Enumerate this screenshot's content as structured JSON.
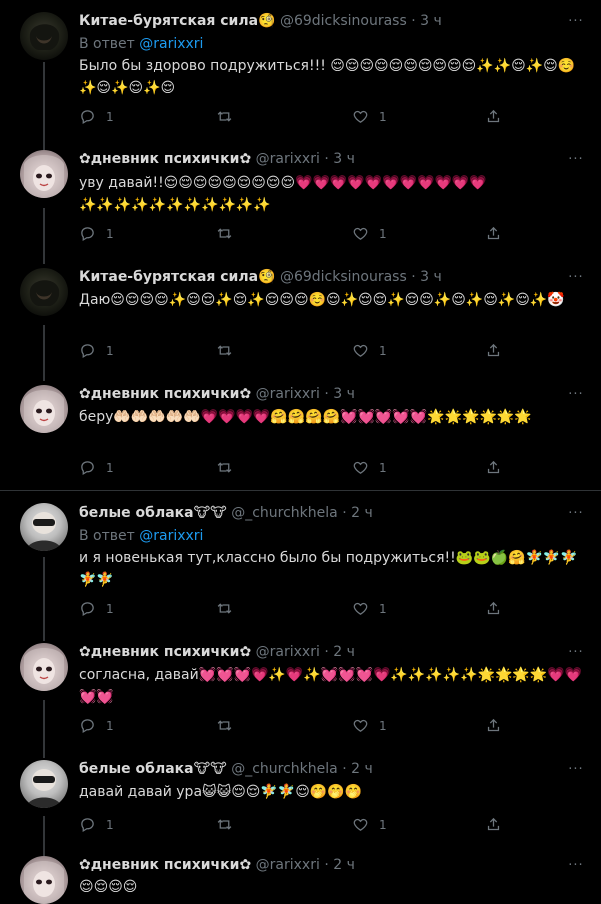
{
  "tweets": [
    {
      "name": "Китае-бурятская сила🧐",
      "handle": "@69dicksinourass",
      "dot": "·",
      "time": "3 ч",
      "reply_prefix": "В ответ ",
      "reply_to": "@rarixxri",
      "text": "Было бы здорово подружиться!!! 😌😌😌😌😌😌😌😌😌😌✨✨😌✨😌☺️✨😌✨😌✨😌",
      "replies": "1",
      "retweets": "",
      "likes": "1"
    },
    {
      "name": "✿дневник психички✿",
      "handle": "@rarixxri",
      "dot": "·",
      "time": "3 ч",
      "text": "уву давай!!😌😌😌😌😌😌😌😌😌💗💗💗💗💗💗💗💗💗💗💗✨✨✨✨✨✨✨✨✨✨✨",
      "replies": "1",
      "retweets": "",
      "likes": "1"
    },
    {
      "name": "Китае-бурятская сила🧐",
      "handle": "@69dicksinourass",
      "dot": "·",
      "time": "3 ч",
      "text": "Даю😌😌😌😌✨😌😌✨😌✨😌😌😌☺️😌✨😌😌✨😌😌✨😌✨😌✨😌✨🤡",
      "replies": "1",
      "retweets": "",
      "likes": "1"
    },
    {
      "name": "✿дневник психички✿",
      "handle": "@rarixxri",
      "dot": "·",
      "time": "3 ч",
      "text": "беру🤲🏻🤲🏻🤲🏻🤲🏻🤲🏻💗💗💗💗🤗🤗🤗🤗💓💓💓💓💓🌟🌟🌟🌟🌟🌟",
      "replies": "1",
      "retweets": "",
      "likes": "1"
    },
    {
      "name": "белые облака🐮🐮",
      "handle": "@_churchkhela",
      "dot": "·",
      "time": "2 ч",
      "reply_prefix": "В ответ ",
      "reply_to": "@rarixxri",
      "text": "и я новенькая тут,классно было бы подружиться!!🐸🐸🍏🤗🧚🧚🧚🧚🧚",
      "replies": "1",
      "retweets": "",
      "likes": "1"
    },
    {
      "name": "✿дневник психички✿",
      "handle": "@rarixxri",
      "dot": "·",
      "time": "2 ч",
      "text": "согласна, давай💓💓💓💗✨💗✨💓💓💓💗✨✨✨✨✨🌟🌟🌟🌟💗💗💓💓",
      "replies": "1",
      "retweets": "",
      "likes": "1"
    },
    {
      "name": "белые облака🐮🐮",
      "handle": "@_churchkhela",
      "dot": "·",
      "time": "2 ч",
      "text": "давай давай ура😺😺😌😌🧚🧚😌🤭🤭🤭",
      "replies": "1",
      "retweets": "",
      "likes": "1"
    },
    {
      "name": "✿дневник психички✿",
      "handle": "@rarixxri",
      "dot": "·",
      "time": "2 ч",
      "text": "😌😌😌😌"
    }
  ],
  "more_label": "···",
  "colors": {
    "background": "#000000",
    "text": "#d9d9d9",
    "muted": "#6e767d",
    "link": "#1d9bf0",
    "thread_line": "#333639",
    "separator": "#2f3336"
  },
  "icons": {
    "reply": "reply-icon",
    "retweet": "retweet-icon",
    "like": "like-icon",
    "share": "share-icon",
    "more": "more-icon"
  }
}
